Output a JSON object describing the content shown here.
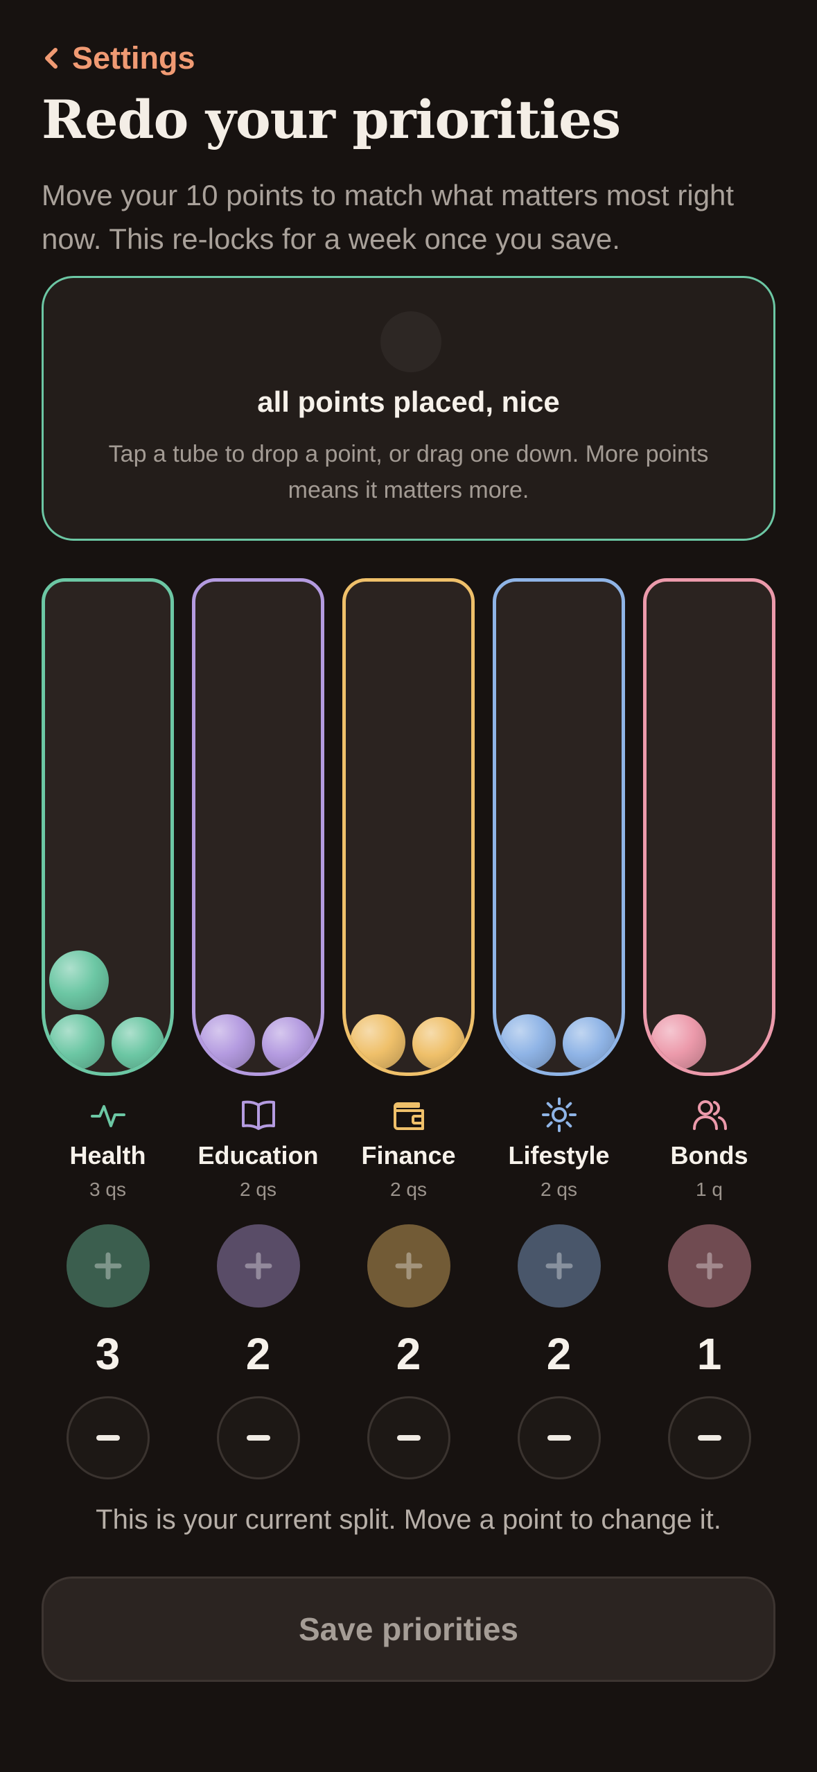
{
  "nav": {
    "back_label": "Settings"
  },
  "header": {
    "title": "Redo your priorities",
    "subtitle": "Move your 10 points to match what matters most right now. This re-locks for a week once you save."
  },
  "status": {
    "heading": "all points placed, nice",
    "hint": "Tap a tube to drop a point, or drag one down. More points means it matters more."
  },
  "categories": [
    {
      "name": "Health",
      "count_label": "3 qs",
      "points": "3",
      "points_value": 3,
      "color": "#6cc7a4",
      "icon": "pulse-icon"
    },
    {
      "name": "Education",
      "count_label": "2 qs",
      "points": "2",
      "points_value": 2,
      "color": "#b49be0",
      "icon": "book-icon"
    },
    {
      "name": "Finance",
      "count_label": "2 qs",
      "points": "2",
      "points_value": 2,
      "color": "#efc06a",
      "icon": "wallet-icon"
    },
    {
      "name": "Lifestyle",
      "count_label": "2 qs",
      "points": "2",
      "points_value": 2,
      "color": "#8fb4e6",
      "icon": "sun-icon"
    },
    {
      "name": "Bonds",
      "count_label": "1 q",
      "points": "1",
      "points_value": 1,
      "color": "#ec9aab",
      "icon": "people-icon"
    }
  ],
  "footer": {
    "note": "This is your current split. Move a point to change it.",
    "save_label": "Save priorities"
  }
}
